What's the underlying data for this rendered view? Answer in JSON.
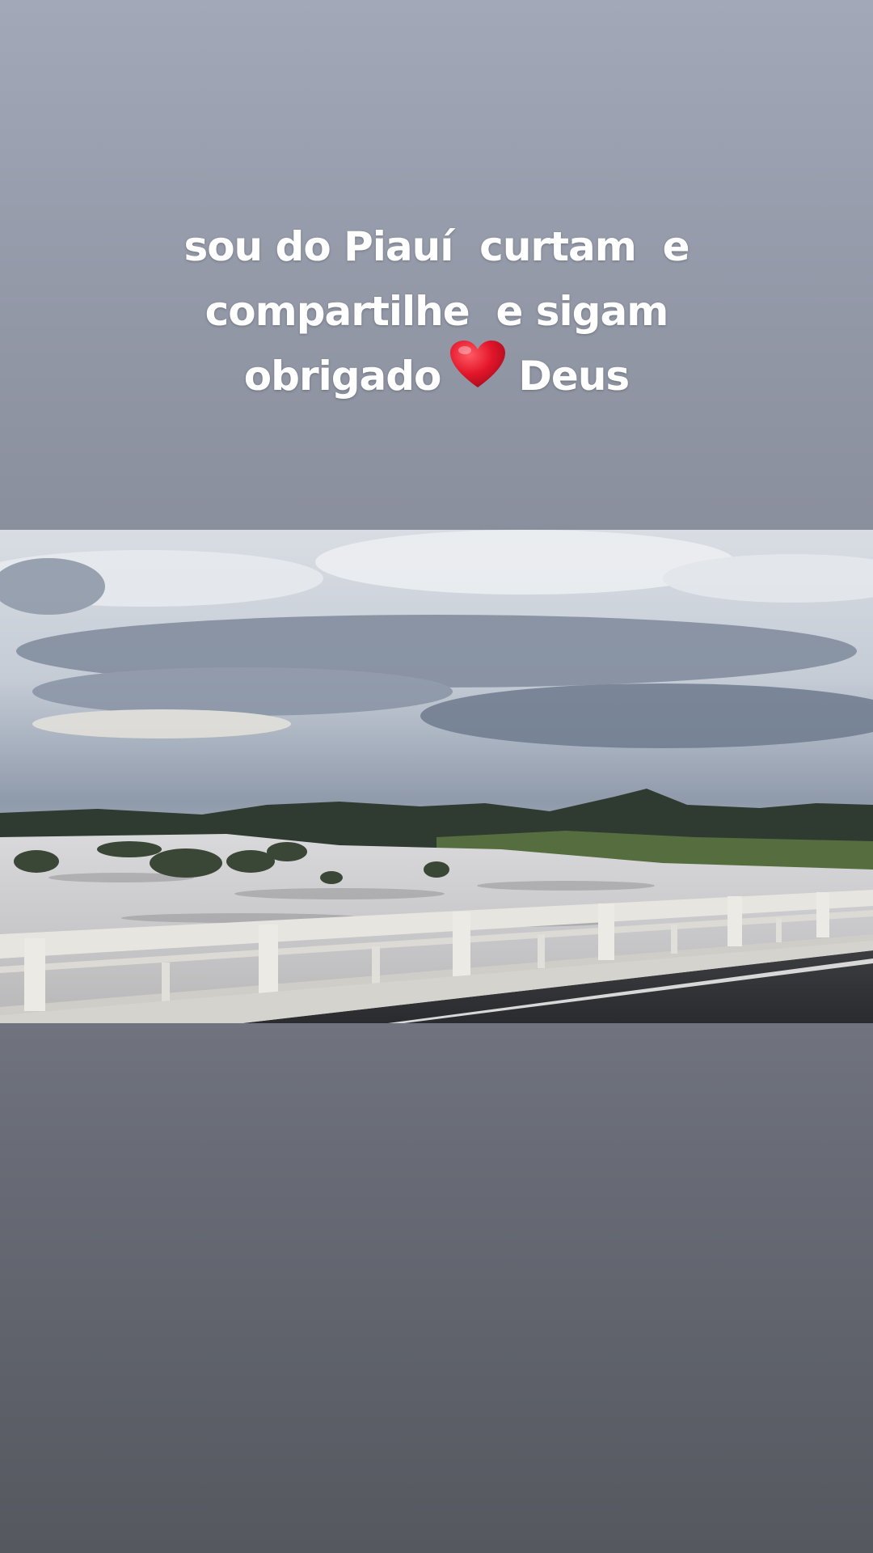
{
  "caption": {
    "line1": "sou do Piauí  curtam  e",
    "line2": "compartilhe  e sigam",
    "line3_before": "obrigado",
    "line3_emoji": "red-heart-emoji",
    "line3_after": "Deus"
  },
  "media": {
    "type": "video-frame",
    "scene": "flooded-river-from-bridge"
  },
  "colors": {
    "background_top": "#a2a8b8",
    "background_bottom": "#55585f",
    "caption_text": "#ffffff",
    "heart": "#e3162b"
  }
}
